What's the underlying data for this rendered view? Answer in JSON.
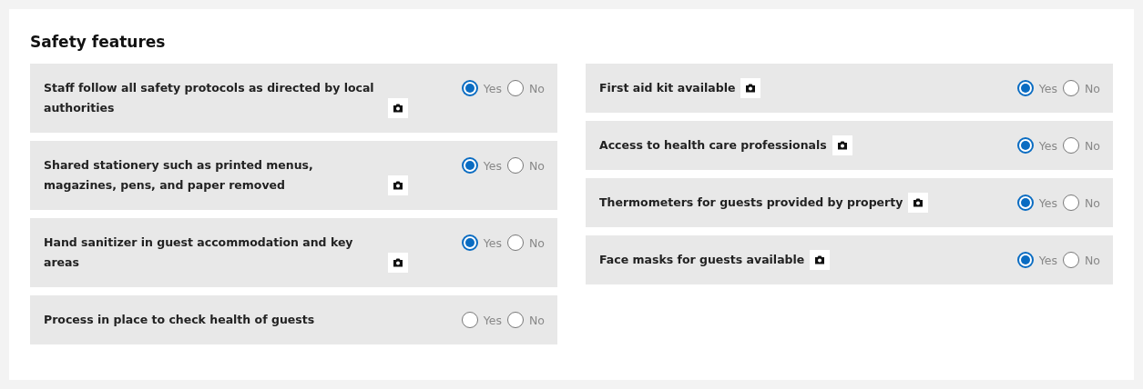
{
  "section": {
    "title": "Safety features"
  },
  "columns": [
    {
      "items": [
        {
          "label": "Staff follow all safety protocols as directed by local authorities",
          "photo": true,
          "options": [
            {
              "label": "Yes",
              "selected": true
            },
            {
              "label": "No",
              "selected": false
            }
          ]
        },
        {
          "label": "Shared stationery such as printed menus, magazines, pens, and paper removed",
          "photo": true,
          "options": [
            {
              "label": "Yes",
              "selected": true
            },
            {
              "label": "No",
              "selected": false
            }
          ]
        },
        {
          "label": "Hand sanitizer in guest accommodation and key areas",
          "photo": true,
          "options": [
            {
              "label": "Yes",
              "selected": true
            },
            {
              "label": "No",
              "selected": false
            }
          ]
        },
        {
          "label": "Process in place to check health of guests",
          "photo": false,
          "options": [
            {
              "label": "Yes",
              "selected": false
            },
            {
              "label": "No",
              "selected": false
            }
          ]
        }
      ]
    },
    {
      "items": [
        {
          "label": "First aid kit available",
          "photo": true,
          "options": [
            {
              "label": "Yes",
              "selected": true
            },
            {
              "label": "No",
              "selected": false
            }
          ]
        },
        {
          "label": "Access to health care professionals",
          "photo": true,
          "options": [
            {
              "label": "Yes",
              "selected": true
            },
            {
              "label": "No",
              "selected": false
            }
          ]
        },
        {
          "label": "Thermometers for guests provided by property",
          "photo": true,
          "options": [
            {
              "label": "Yes",
              "selected": true
            },
            {
              "label": "No",
              "selected": false
            }
          ]
        },
        {
          "label": "Face masks for guests available",
          "photo": true,
          "options": [
            {
              "label": "Yes",
              "selected": true
            },
            {
              "label": "No",
              "selected": false
            }
          ]
        }
      ]
    }
  ]
}
